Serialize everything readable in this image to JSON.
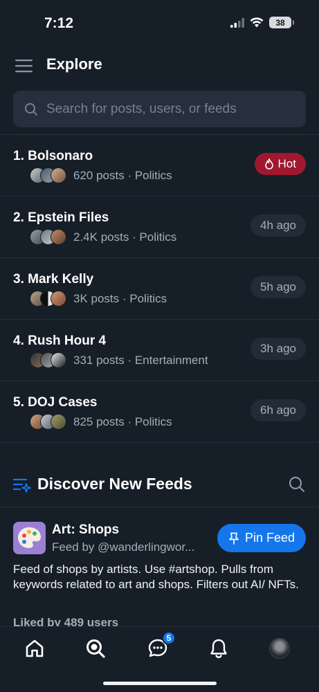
{
  "status_bar": {
    "time": "7:12",
    "battery": "38"
  },
  "header": {
    "title": "Explore"
  },
  "search": {
    "placeholder": "Search for posts, users, or feeds"
  },
  "trending": [
    {
      "title": "1. Bolsonaro",
      "meta": "620 posts · Politics",
      "badge": "Hot",
      "hot": true
    },
    {
      "title": "2. Epstein Files",
      "meta": "2.4K posts · Politics",
      "badge": "4h ago",
      "hot": false
    },
    {
      "title": "3. Mark Kelly",
      "meta": "3K posts · Politics",
      "badge": "5h ago",
      "hot": false
    },
    {
      "title": "4. Rush Hour 4",
      "meta": "331 posts · Entertainment",
      "badge": "3h ago",
      "hot": false
    },
    {
      "title": "5. DOJ Cases",
      "meta": "825 posts · Politics",
      "badge": "6h ago",
      "hot": false
    }
  ],
  "discover": {
    "title": "Discover New Feeds",
    "feed": {
      "name": "Art: Shops",
      "by": "Feed by @wanderlingwor...",
      "pin_label": "Pin Feed",
      "description": "Feed of shops by artists. Use #artshop. Pulls from keywords related to art and shops. Filters out AI/ NFTs.",
      "likes": "Liked by 489 users"
    }
  },
  "tab_bar": {
    "items": [
      "home-icon",
      "search-icon",
      "chat-icon",
      "bell-icon",
      "profile-avatar"
    ],
    "chat_badge": "5"
  },
  "colors": {
    "accent": "#1576ec",
    "hot": "#a0172f",
    "background": "#161e27"
  }
}
